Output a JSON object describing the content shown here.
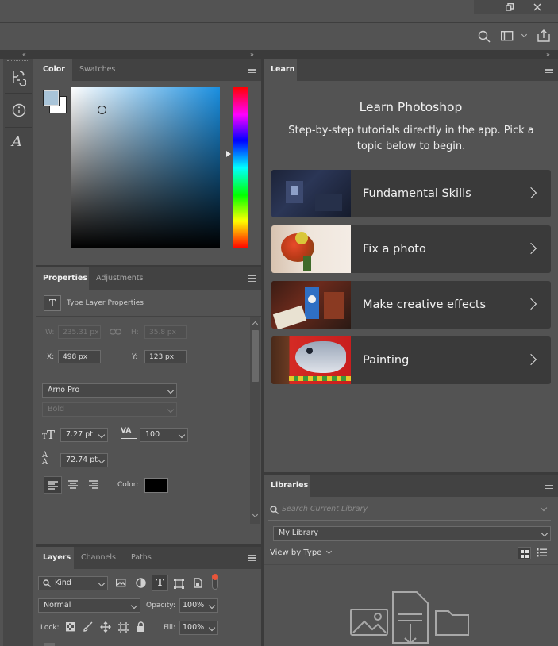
{
  "colors": {
    "bg": "#535353",
    "panel_header": "#424242",
    "accent": "#2d8ceb",
    "foreground_swatch": "#a9c4d8",
    "type_color": "#000000"
  },
  "toolbar": {
    "icons": [
      "search-icon",
      "workspace-icon",
      "share-icon"
    ]
  },
  "color_panel": {
    "tabs": [
      {
        "label": "Color"
      },
      {
        "label": "Swatches"
      }
    ]
  },
  "properties_panel": {
    "tabs": [
      {
        "label": "Properties"
      },
      {
        "label": "Adjustments"
      }
    ],
    "layer_type": "Type Layer Properties",
    "w_label": "W:",
    "w_value": "235.31 px",
    "h_label": "H:",
    "h_value": "35.8 px",
    "x_label": "X:",
    "x_value": "498 px",
    "y_label": "Y:",
    "y_value": "123 px",
    "font_family": "Arno Pro",
    "font_style": "Bold",
    "font_size": "7.27 pt",
    "tracking": "100",
    "leading": "72.74 pt",
    "color_label": "Color:"
  },
  "layers_panel": {
    "tabs": [
      {
        "label": "Layers"
      },
      {
        "label": "Channels"
      },
      {
        "label": "Paths"
      }
    ],
    "filter_kind": "Kind",
    "blend_mode": "Normal",
    "opacity_label": "Opacity:",
    "opacity_value": "100%",
    "lock_label": "Lock:",
    "fill_label": "Fill:",
    "fill_value": "100%"
  },
  "learn_panel": {
    "tab": "Learn",
    "title": "Learn Photoshop",
    "subtitle": "Step-by-step tutorials directly in the app. Pick a topic below to begin.",
    "items": [
      {
        "title": "Fundamental Skills"
      },
      {
        "title": "Fix a photo"
      },
      {
        "title": "Make creative effects"
      },
      {
        "title": "Painting"
      }
    ]
  },
  "libraries_panel": {
    "tab": "Libraries",
    "search_placeholder": "Search Current Library",
    "library": "My Library",
    "view_by": "View by Type"
  }
}
